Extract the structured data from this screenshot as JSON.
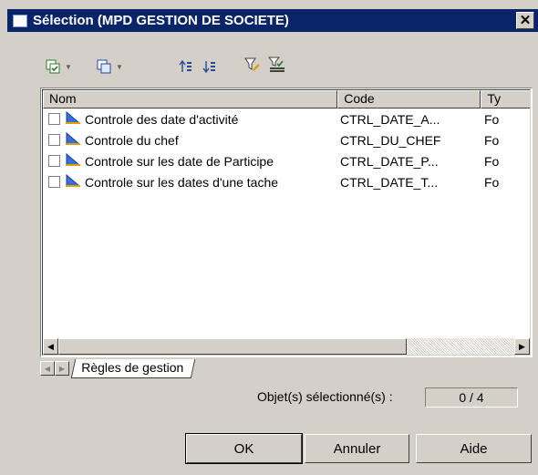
{
  "window": {
    "title": "Sélection (MPD GESTION DE SOCIETE)",
    "close_label": "✕"
  },
  "toolbar": {
    "items": [
      {
        "icon": "select-all-icon",
        "has_dropdown": true
      },
      {
        "icon": "copy-select-icon",
        "has_dropdown": true
      },
      {
        "icon": "move-up-icon"
      },
      {
        "icon": "move-down-icon"
      },
      {
        "icon": "filter-icon"
      },
      {
        "icon": "filter-selected-icon"
      }
    ]
  },
  "list": {
    "columns": [
      "Nom",
      "Code",
      "Ty"
    ],
    "rows": [
      {
        "name": "Controle des date d'activité",
        "code": "CTRL_DATE_A...",
        "type": "Fo",
        "checked": false
      },
      {
        "name": "Controle du chef",
        "code": "CTRL_DU_CHEF",
        "type": "Fo",
        "checked": false
      },
      {
        "name": "Controle sur les date de Participe",
        "code": "CTRL_DATE_P...",
        "type": "Fo",
        "checked": false
      },
      {
        "name": "Controle sur les dates d'une tache",
        "code": "CTRL_DATE_T...",
        "type": "Fo",
        "checked": false
      }
    ]
  },
  "tabs": {
    "active": "Règles de gestion"
  },
  "status": {
    "label": "Objet(s) sélectionné(s) :",
    "value": "0 / 4"
  },
  "buttons": {
    "ok": "OK",
    "cancel": "Annuler",
    "help": "Aide"
  },
  "colors": {
    "titlebar": "#0a246a",
    "dialog": "#d4d0c8",
    "rule_icon": "#3a6fd8"
  }
}
